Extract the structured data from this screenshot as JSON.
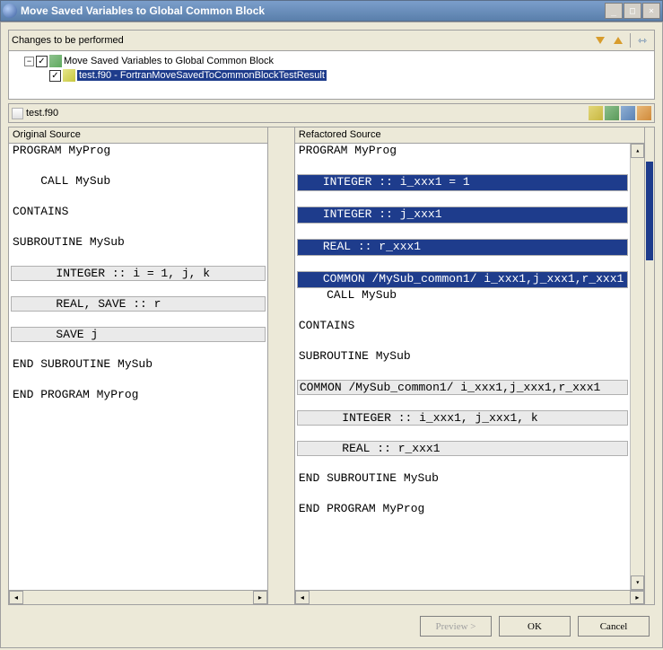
{
  "window": {
    "title": "Move Saved Variables to Global Common Block"
  },
  "changes": {
    "heading": "Changes to be performed",
    "tree": {
      "root": "Move Saved Variables to Global Common Block",
      "child": "test.f90 - FortranMoveSavedToCommonBlockTestResult"
    }
  },
  "fileTab": {
    "name": "test.f90"
  },
  "panes": {
    "original": "Original Source",
    "refactored": "Refactored Source"
  },
  "original": {
    "l1": "PROGRAM MyProg",
    "l2": "    CALL MySub",
    "l3": "CONTAINS",
    "l4": "SUBROUTINE MySub",
    "l5": "   INTEGER :: i = 1, j, k",
    "l6": "   REAL, SAVE :: r",
    "l7": "   SAVE j",
    "l8": "END SUBROUTINE MySub",
    "l9": "END PROGRAM MyProg"
  },
  "refactored": {
    "l1": "PROGRAM MyProg",
    "l2": "INTEGER :: i_xxx1 = 1",
    "l3": "INTEGER :: j_xxx1",
    "l4": "REAL :: r_xxx1",
    "l5": "COMMON /MySub_common1/ i_xxx1,j_xxx1,r_xxx1",
    "l6": "    CALL MySub",
    "l7": "CONTAINS",
    "l8": "SUBROUTINE MySub",
    "l9": "COMMON /MySub_common1/ i_xxx1,j_xxx1,r_xxx1",
    "l10": "   INTEGER :: i_xxx1, j_xxx1, k",
    "l11": "   REAL :: r_xxx1",
    "l12": "END SUBROUTINE MySub",
    "l13": "END PROGRAM MyProg"
  },
  "buttons": {
    "preview": "Preview >",
    "ok": "OK",
    "cancel": "Cancel"
  }
}
